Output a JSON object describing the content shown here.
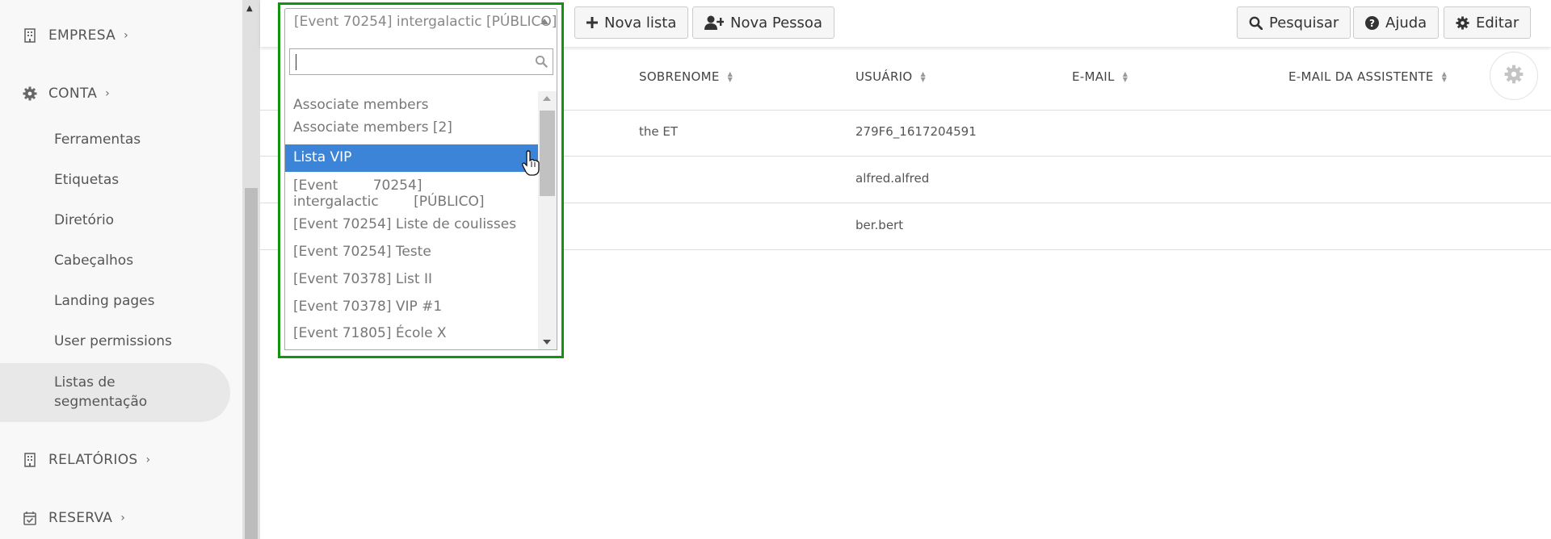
{
  "sidebar": {
    "sections": {
      "empresa": "EMPRESA",
      "conta": "CONTA",
      "relatorios": "RELATÓRIOS",
      "reserva": "RESERVA"
    },
    "items": [
      "Ferramentas",
      "Etiquetas",
      "Diretório",
      "Cabeçalhos",
      "Landing pages",
      "User permissions"
    ],
    "active_item_line1": "Listas de",
    "active_item_line2": "segmentação"
  },
  "toolbar": {
    "nova_lista": "Nova lista",
    "nova_pessoa": "Nova Pessoa",
    "pesquisar": "Pesquisar",
    "ajuda": "Ajuda",
    "editar": "Editar"
  },
  "dropdown": {
    "selected": "[Event 70254] intergalactic [PÚBLICO]",
    "search_value": "",
    "options": [
      "Associate members",
      "Associate members [2]",
      "Lista VIP",
      "[Event 70254] intergalactic [PÚBLICO]",
      "[Event 70254] Liste de coulisses",
      "[Event 70254] Teste",
      "[Event 70378] List II",
      "[Event 70378] VIP #1",
      "[Event 71805] École X"
    ],
    "highlighted": "Lista VIP"
  },
  "table": {
    "columns": [
      "SOBRENOME",
      "USUÁRIO",
      "E-MAIL",
      "E-MAIL DA ASSISTENTE"
    ],
    "rows": [
      {
        "sobrenome": "the ET",
        "usuario": "279F6_1617204591",
        "email": "",
        "email_assistente": ""
      },
      {
        "sobrenome": "",
        "usuario": "alfred.alfred",
        "email": "",
        "email_assistente": ""
      },
      {
        "sobrenome": "",
        "usuario": "ber.bert",
        "email": "",
        "email_assistente": ""
      }
    ]
  },
  "colors": {
    "highlight": "#3c84d8",
    "frame": "#13930f",
    "sidebar_bg": "#f8f8f8"
  }
}
